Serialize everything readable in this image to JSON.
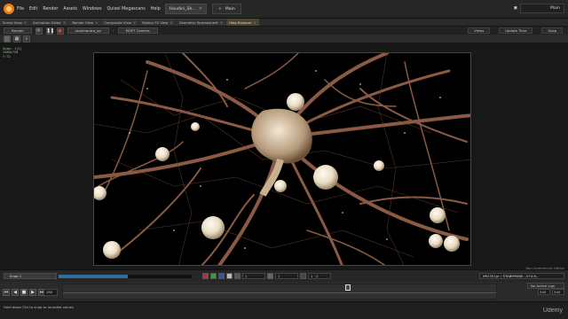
{
  "menubar": {
    "items": [
      "File",
      "Edit",
      "Render",
      "Assets",
      "Windows",
      "Quixel Megascans",
      "Help"
    ],
    "window_tabs": [
      {
        "label": "Houdini_Sh..."
      },
      {
        "label": "Main"
      }
    ],
    "desktop_label": "Main"
  },
  "tabstrip": {
    "tabs": [
      {
        "label": "Scene View",
        "active": false
      },
      {
        "label": "Animation Editor",
        "active": false
      },
      {
        "label": "Render View",
        "active": false
      },
      {
        "label": "Composite View",
        "active": false
      },
      {
        "label": "Motion FX View",
        "active": false
      },
      {
        "label": "Geometry Spreadsheet",
        "active": false
      },
      {
        "label": "Help Browser",
        "active": true
      }
    ]
  },
  "pathrow": {
    "path_items": [
      "Render",
      "/out/mantra_ipr",
      "MOPT Camera"
    ],
    "right_items": [
      "Views",
      "Update Time",
      "Snap"
    ]
  },
  "overlay": {
    "lines": [
      "Snap: 1[1]",
      "1280x720",
      "f:72"
    ]
  },
  "watermark": "Non-Commercial Edition",
  "playbar": {
    "snapshot_label": "Snap 1",
    "progress": 0.52,
    "status": "IMG3Y.1pr / STABMPANE...074.6...",
    "field1": "1",
    "field2": "1",
    "field3": "1 : 2"
  },
  "timeline": {
    "frame": "192",
    "start": "240",
    "end": "240",
    "keys_label": "No Active Ligs"
  },
  "statusbar": {
    "message": "Hold down Ctrl to snap to rounded values"
  },
  "brand": "Udemy"
}
